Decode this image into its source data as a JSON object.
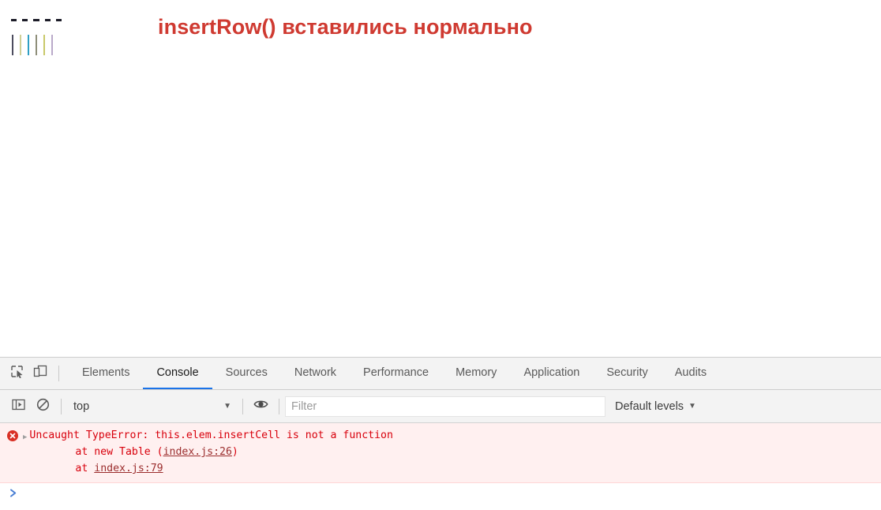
{
  "page": {
    "heading": "insertRow() вставились нормально",
    "heading_color": "#cf3a31",
    "mini_table": {
      "dash_count": 5,
      "dash_color": "#1c1c28",
      "bar_colors": [
        "#4c4c5e",
        "#cfcf96",
        "#2f9fc4",
        "#8f8f7a",
        "#c9c96a",
        "#b9a9c9"
      ]
    }
  },
  "devtools": {
    "toolbar_icons": [
      {
        "name": "inspect-element-icon",
        "title": "Inspect"
      },
      {
        "name": "device-toolbar-icon",
        "title": "Toggle device toolbar"
      }
    ],
    "tabs": [
      {
        "label": "Elements",
        "active": false
      },
      {
        "label": "Console",
        "active": true
      },
      {
        "label": "Sources",
        "active": false
      },
      {
        "label": "Network",
        "active": false
      },
      {
        "label": "Performance",
        "active": false
      },
      {
        "label": "Memory",
        "active": false
      },
      {
        "label": "Application",
        "active": false
      },
      {
        "label": "Security",
        "active": false
      },
      {
        "label": "Audits",
        "active": false
      }
    ],
    "active_tab_underline_color": "#1a73e8",
    "filterbar": {
      "sidebar_toggle": "console-sidebar-icon",
      "clear_console": "clear-console-icon",
      "context_value": "top",
      "context_caret": "▼",
      "eye_icon": "live-expression-eye-icon",
      "filter_placeholder": "Filter",
      "filter_value": "",
      "levels_label": "Default levels",
      "levels_caret": "▼"
    },
    "console": {
      "messages": [
        {
          "type": "error",
          "icon": "error-circle-icon",
          "expander": "▶",
          "line1": "Uncaught TypeError: this.elem.insertCell is not a function",
          "stack": [
            {
              "prefix": "at new Table (",
              "link": "index.js:26",
              "suffix": ")"
            },
            {
              "prefix": "at ",
              "link": "index.js:79",
              "suffix": ""
            }
          ]
        }
      ],
      "prompt_symbol": "❯",
      "prompt_value": ""
    }
  }
}
